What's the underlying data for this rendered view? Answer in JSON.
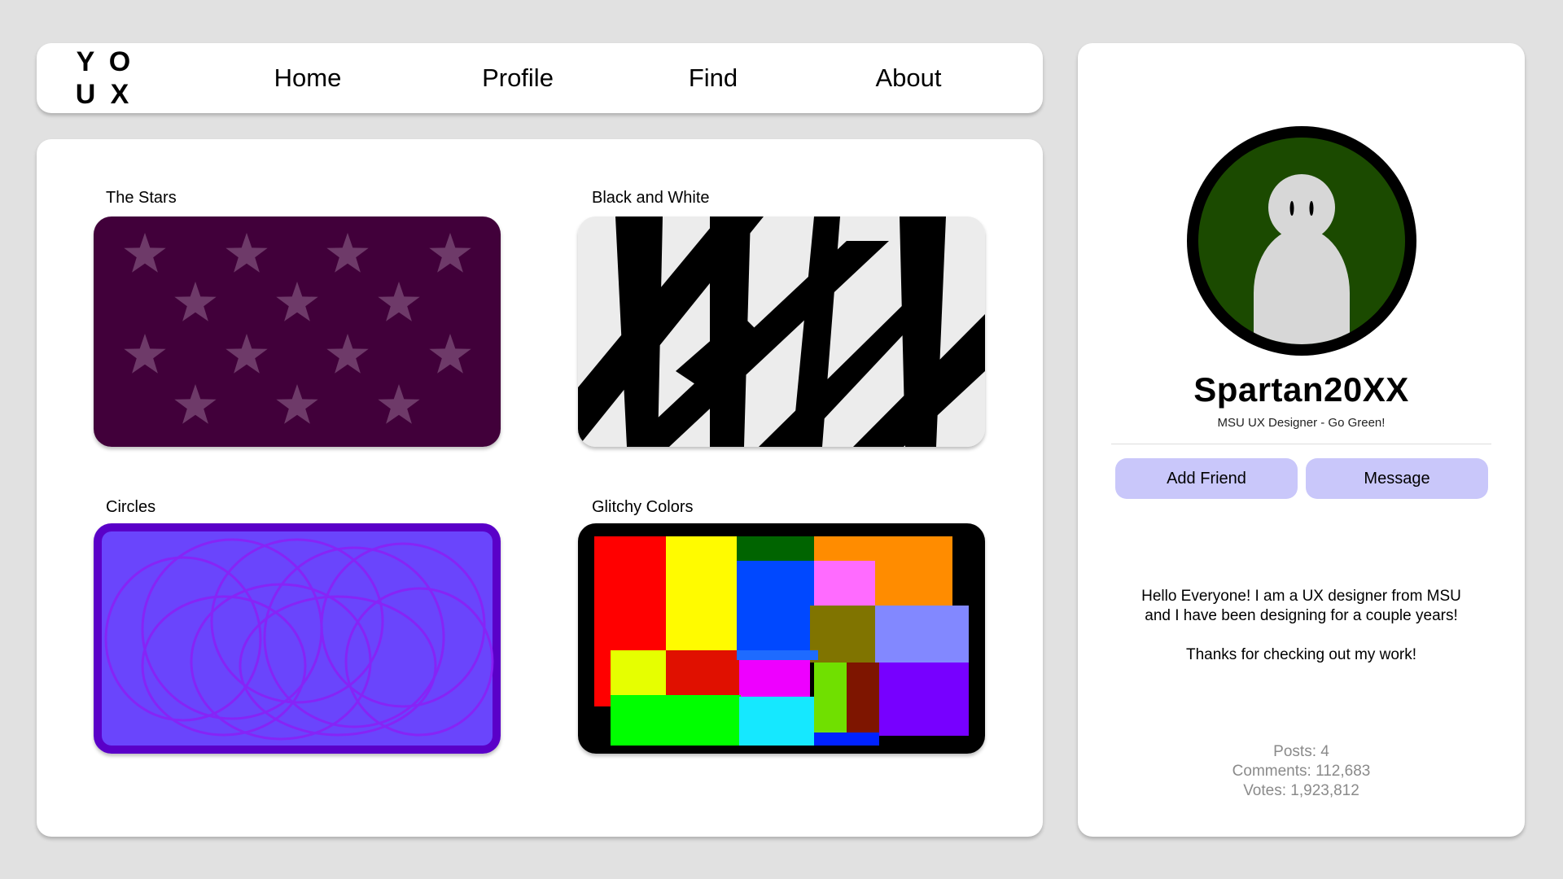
{
  "nav": {
    "logo": [
      "Y",
      "O",
      "U",
      "X"
    ],
    "links": [
      "Home",
      "Profile",
      "Find",
      "About"
    ]
  },
  "gallery": {
    "items": [
      {
        "title": "The Stars"
      },
      {
        "title": "Black and White"
      },
      {
        "title": "Circles"
      },
      {
        "title": "Glitchy Colors"
      }
    ]
  },
  "profile": {
    "username": "Spartan20XX",
    "tagline": "MSU UX Designer - Go Green!",
    "add_friend_label": "Add Friend",
    "message_label": "Message",
    "bio_line1": "Hello Everyone! I am a UX designer from MSU",
    "bio_line2": "and I have been designing for a couple years!",
    "bio_line3": "Thanks for checking out my work!",
    "posts": "Posts: 4",
    "comments": "Comments: 112,683",
    "votes": "Votes: 1,923,812"
  },
  "colors": {
    "background": "#e1e1e1",
    "button": "#c9c7fa",
    "avatar_green": "#1b4a00",
    "stars_bg": "#41003a",
    "circles_bg": "#6a45fc"
  }
}
